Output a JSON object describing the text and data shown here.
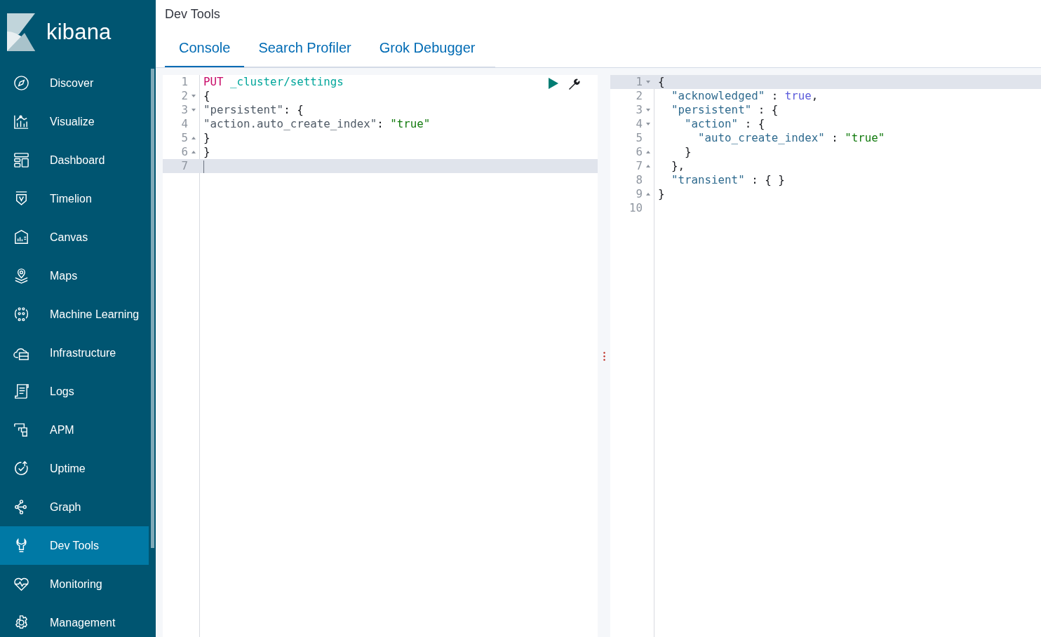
{
  "sidebar": {
    "logo": "kibana",
    "items": [
      {
        "label": "Discover",
        "selected": false
      },
      {
        "label": "Visualize",
        "selected": false
      },
      {
        "label": "Dashboard",
        "selected": false
      },
      {
        "label": "Timelion",
        "selected": false
      },
      {
        "label": "Canvas",
        "selected": false
      },
      {
        "label": "Maps",
        "selected": false
      },
      {
        "label": "Machine Learning",
        "selected": false
      },
      {
        "label": "Infrastructure",
        "selected": false
      },
      {
        "label": "Logs",
        "selected": false
      },
      {
        "label": "APM",
        "selected": false
      },
      {
        "label": "Uptime",
        "selected": false
      },
      {
        "label": "Graph",
        "selected": false
      },
      {
        "label": "Dev Tools",
        "selected": true
      },
      {
        "label": "Monitoring",
        "selected": false
      },
      {
        "label": "Management",
        "selected": false
      }
    ]
  },
  "header": {
    "title": "Dev Tools"
  },
  "tabs": [
    {
      "label": "Console",
      "selected": true
    },
    {
      "label": "Search Profiler",
      "selected": false
    },
    {
      "label": "Grok Debugger",
      "selected": false
    }
  ],
  "request_editor": {
    "lines": [
      {
        "number": "1",
        "kind": "plain",
        "active": false,
        "tokens": [
          {
            "text": "PUT",
            "kind": "method"
          },
          {
            "text": " _cluster/settings",
            "kind": "url"
          }
        ]
      },
      {
        "number": "2",
        "kind": "opener",
        "active": false,
        "tokens": [
          {
            "text": "{",
            "kind": "punct"
          }
        ]
      },
      {
        "number": "3",
        "kind": "opener",
        "active": false,
        "tokens": [
          {
            "text": "\"persistent\"",
            "kind": "key"
          },
          {
            "text": ": {",
            "kind": "punct"
          }
        ]
      },
      {
        "number": "4",
        "kind": "plain",
        "active": false,
        "tokens": [
          {
            "text": "\"action.auto_create_index\"",
            "kind": "key"
          },
          {
            "text": ": ",
            "kind": "punct"
          },
          {
            "text": "\"true\"",
            "kind": "string"
          }
        ]
      },
      {
        "number": "5",
        "kind": "closer",
        "active": false,
        "tokens": [
          {
            "text": "}",
            "kind": "punct"
          }
        ]
      },
      {
        "number": "6",
        "kind": "closer",
        "active": false,
        "tokens": [
          {
            "text": "}",
            "kind": "punct"
          }
        ]
      },
      {
        "number": "7",
        "kind": "plain",
        "active": true
      }
    ]
  },
  "response_viewer": {
    "lines": [
      {
        "number": "1",
        "kind": "opener",
        "active": true,
        "tokens": [
          {
            "text": "{",
            "kind": "punct"
          }
        ]
      },
      {
        "number": "2",
        "kind": "plain",
        "active": false,
        "tokens": [
          {
            "text": "  \"acknowledged\"",
            "kind": "property"
          },
          {
            "text": " : ",
            "kind": "punct"
          },
          {
            "text": "true",
            "kind": "boolean"
          },
          {
            "text": ",",
            "kind": "punct"
          }
        ]
      },
      {
        "number": "3",
        "kind": "opener",
        "active": false,
        "tokens": [
          {
            "text": "  \"persistent\"",
            "kind": "property"
          },
          {
            "text": " : {",
            "kind": "punct"
          }
        ]
      },
      {
        "number": "4",
        "kind": "opener",
        "active": false,
        "tokens": [
          {
            "text": "    \"action\"",
            "kind": "property"
          },
          {
            "text": " : {",
            "kind": "punct"
          }
        ]
      },
      {
        "number": "5",
        "kind": "plain",
        "active": false,
        "tokens": [
          {
            "text": "      \"auto_create_index\"",
            "kind": "property"
          },
          {
            "text": " : ",
            "kind": "punct"
          },
          {
            "text": "\"true\"",
            "kind": "string"
          }
        ]
      },
      {
        "number": "6",
        "kind": "closer",
        "active": false,
        "tokens": [
          {
            "text": "    }",
            "kind": "punct"
          }
        ]
      },
      {
        "number": "7",
        "kind": "closer",
        "active": false,
        "tokens": [
          {
            "text": "  },",
            "kind": "punct"
          }
        ]
      },
      {
        "number": "8",
        "kind": "plain",
        "active": false,
        "tokens": [
          {
            "text": "  \"transient\"",
            "kind": "property"
          },
          {
            "text": " : { }",
            "kind": "punct"
          }
        ]
      },
      {
        "number": "9",
        "kind": "closer",
        "active": false,
        "tokens": [
          {
            "text": "}",
            "kind": "punct"
          }
        ]
      },
      {
        "number": "10",
        "kind": "plain",
        "active": false
      }
    ]
  }
}
